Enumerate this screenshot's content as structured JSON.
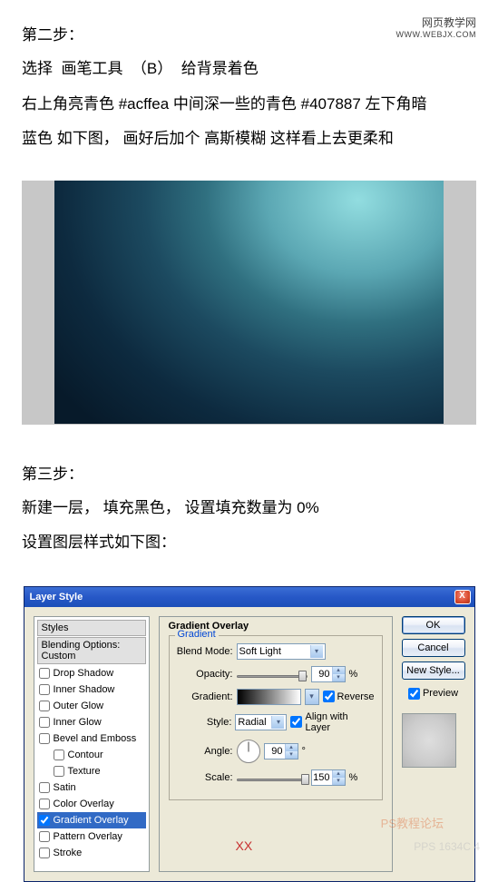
{
  "watermark": {
    "line1": "网页教学网",
    "line2": "WWW.WEBJX.COM"
  },
  "step2": {
    "title": "第二步：",
    "line1_a": "选择",
    "line1_b": "画笔工具",
    "line1_c": "（B）",
    "line1_d": "给背景着色",
    "line2": "右上角亮青色 #acffea    中间深一些的青色 #407887   左下角暗",
    "line3": "蓝色 如下图，   画好后加个    高斯模糊   这样看上去更柔和"
  },
  "step3": {
    "title": "第三步：",
    "line1": "新建一层，   填充黑色，   设置填充数量为 0%",
    "line2": "设置图层样式如下图："
  },
  "dialog": {
    "title": "Layer Style",
    "close": "X",
    "left": {
      "styles": "Styles",
      "blending": "Blending Options: Custom",
      "dropShadow": "Drop Shadow",
      "innerShadow": "Inner Shadow",
      "outerGlow": "Outer Glow",
      "innerGlow": "Inner Glow",
      "bevel": "Bevel and Emboss",
      "contour": "Contour",
      "texture": "Texture",
      "satin": "Satin",
      "colorOverlay": "Color Overlay",
      "gradientOverlay": "Gradient Overlay",
      "patternOverlay": "Pattern Overlay",
      "stroke": "Stroke"
    },
    "center": {
      "groupTitle": "Gradient Overlay",
      "fieldset": "Gradient",
      "blendMode": "Blend Mode:",
      "blendModeVal": "Soft Light",
      "opacity": "Opacity:",
      "opacityVal": "90",
      "percent": "%",
      "gradient": "Gradient:",
      "reverse": "Reverse",
      "style": "Style:",
      "styleVal": "Radial",
      "align": "Align with Layer",
      "angle": "Angle:",
      "angleVal": "90",
      "degree": "°",
      "scale": "Scale:",
      "scaleVal": "150"
    },
    "right": {
      "ok": "OK",
      "cancel": "Cancel",
      "newStyle": "New Style...",
      "preview": "Preview"
    }
  },
  "bottomWatermark": "PS教程论坛",
  "xx": "XX",
  "bottomRight": "PPS  1634C  4"
}
